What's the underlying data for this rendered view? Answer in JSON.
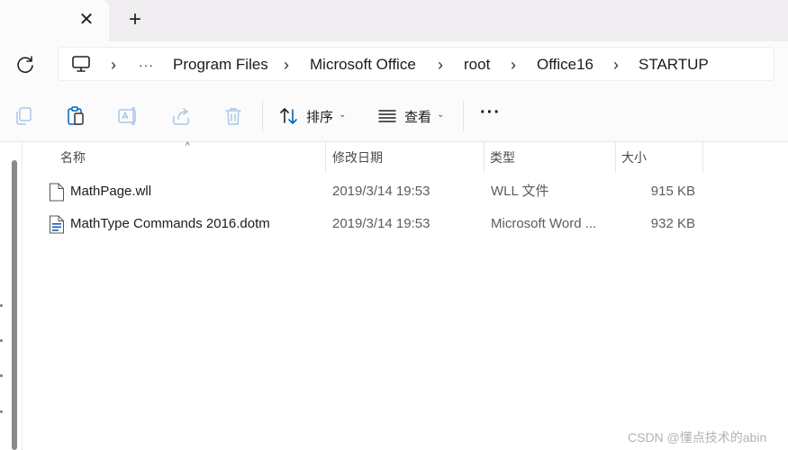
{
  "tabs": {
    "close_glyph": "✕",
    "new_tab_glyph": "+"
  },
  "address": {
    "overflow": "···",
    "separator": "›",
    "crumbs": [
      "Program Files",
      "Microsoft Office",
      "root",
      "Office16",
      "STARTUP"
    ]
  },
  "toolbar": {
    "sort_label": "排序",
    "view_label": "查看",
    "more_glyph": "···",
    "chevron": "⌄",
    "icons": [
      "copy-icon",
      "paste-icon",
      "rename-icon",
      "share-icon",
      "delete-icon",
      "sort-icon",
      "view-icon",
      "more-icon"
    ]
  },
  "columns": {
    "name": "名称",
    "modified": "修改日期",
    "type": "类型",
    "size": "大小",
    "sort_caret": "^"
  },
  "files": [
    {
      "name": "MathPage.wll",
      "modified": "2019/3/14 19:53",
      "type": "WLL 文件",
      "size": "915 KB",
      "icon": "file-icon"
    },
    {
      "name": "MathType Commands 2016.dotm",
      "modified": "2019/3/14 19:53",
      "type": "Microsoft Word ...",
      "size": "932 KB",
      "icon": "word-template-icon"
    }
  ],
  "watermark": "CSDN @懂点技术的abin",
  "colors": {
    "accent": "#0067c0",
    "disabled_icon": "#a9c8e8",
    "tabstrip_bg": "#f0eef0"
  }
}
